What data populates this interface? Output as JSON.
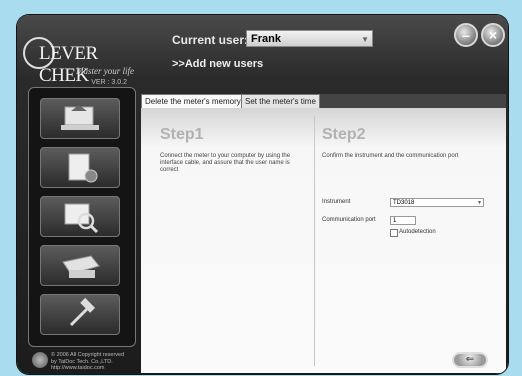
{
  "app": {
    "brand": "LEVER CHEK",
    "tagline": "Master your life",
    "version": "VER : 3.0.2"
  },
  "header": {
    "user_label": "Current user:",
    "user_value": "Frank",
    "add_users": ">>Add new users"
  },
  "window_controls": {
    "minimize_glyph": "–",
    "close_glyph": "×"
  },
  "sidebar": {
    "items": [
      {
        "icon": "computer-upload-icon"
      },
      {
        "icon": "document-settings-icon"
      },
      {
        "icon": "search-document-icon"
      },
      {
        "icon": "printer-icon"
      },
      {
        "icon": "tools-hammer-icon"
      }
    ]
  },
  "copyright": {
    "lines": [
      "© 2006 All Copyright reserved",
      "by TaiDoc Tech. Co.,LTD.",
      "http://www.taidoc.com"
    ]
  },
  "tabs": [
    {
      "label": "Delete the meter's memory"
    },
    {
      "label": "Set the meter's time"
    }
  ],
  "step1": {
    "title": "Step1",
    "text": "Connect the meter to your computer by using the interface cable, and assure that the user name is correct"
  },
  "step2": {
    "title": "Step2",
    "text": "Confirm the instrument and the communication port",
    "instrument_label": "Instrument",
    "instrument_value": "TD3018",
    "port_label": "Communication port",
    "port_value": "1",
    "autodetect_label": "Autodetection",
    "autodetect_checked": false
  },
  "back_button": {
    "glyph": "⇐"
  }
}
